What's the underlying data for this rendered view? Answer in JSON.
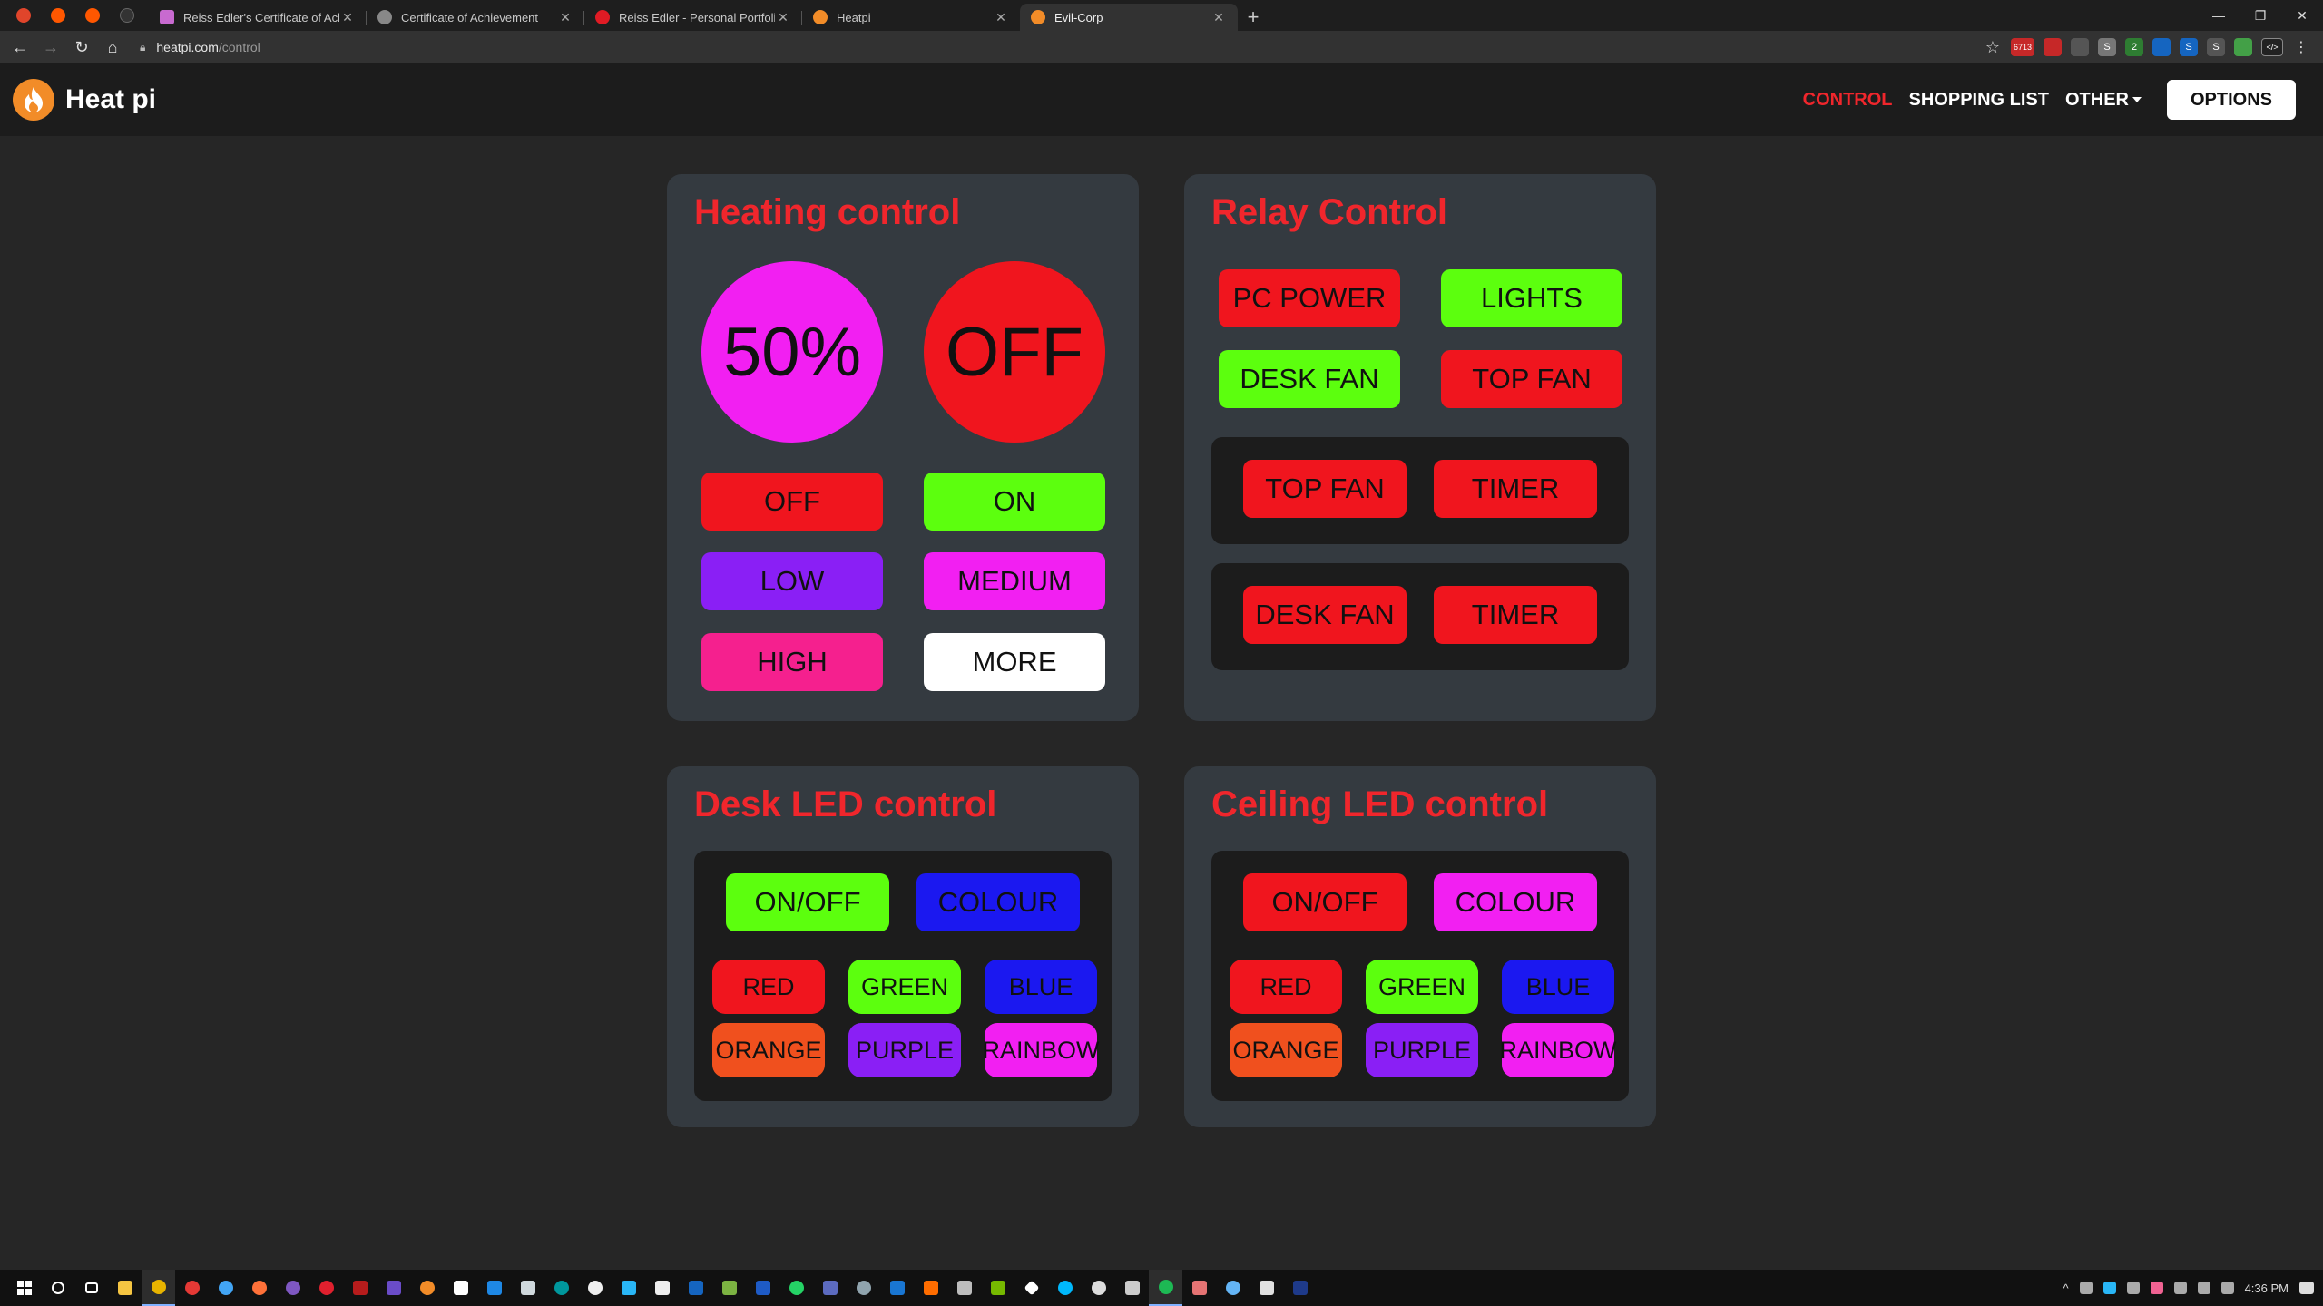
{
  "browser": {
    "pinned_tabs": [
      {
        "icon": "brave-icon",
        "color": "#e0452b"
      },
      {
        "icon": "reddit-icon",
        "color": "#ff5700"
      },
      {
        "icon": "reddit-icon",
        "color": "#ff5700"
      },
      {
        "icon": "github-icon",
        "color": "#333333"
      }
    ],
    "tabs": [
      {
        "title": "Reiss Edler's Certificate of Achievement",
        "favicon_color": "#c86ad0"
      },
      {
        "title": "Certificate of Achievement",
        "favicon_color": "#888888"
      },
      {
        "title": "Reiss Edler - Personal Portfolio",
        "favicon_color": "#e01b24"
      },
      {
        "title": "Heatpi",
        "favicon_color": "#f28c28"
      },
      {
        "title": "Evil-Corp",
        "favicon_color": "#f28c28",
        "active": true
      }
    ],
    "new_tab": "+",
    "url": {
      "host": "heatpi.com",
      "path": "/control"
    },
    "extensions": [
      {
        "label": "6713",
        "color": "#c62828"
      },
      {
        "label": "",
        "color": "#c62828"
      },
      {
        "label": "",
        "color": "#555555"
      },
      {
        "label": "S",
        "color": "#777777"
      },
      {
        "label": "2",
        "color": "#2e7d32"
      },
      {
        "label": "",
        "color": "#1565c0"
      },
      {
        "label": "S",
        "color": "#1565c0"
      },
      {
        "label": "S",
        "color": "#555555"
      },
      {
        "label": "",
        "color": "#43a047"
      },
      {
        "label": "</>",
        "color": "#222222"
      }
    ]
  },
  "app": {
    "brand": "Heat pi",
    "nav": {
      "control": "CONTROL",
      "shopping_list": "SHOPPING LIST",
      "other": "OTHER",
      "options": "OPTIONS"
    },
    "colors": {
      "accent": "#f0262c",
      "card_bg": "#343a40",
      "page_bg": "#262626"
    }
  },
  "heating": {
    "title": "Heating control",
    "level": "50%",
    "state": "OFF",
    "buttons": {
      "off": "OFF",
      "on": "ON",
      "low": "LOW",
      "medium": "MEDIUM",
      "high": "HIGH",
      "more": "MORE"
    }
  },
  "relay": {
    "title": "Relay Control",
    "pc_power": "PC POWER",
    "lights": "LIGHTS",
    "desk_fan": "DESK FAN",
    "top_fan": "TOP FAN",
    "timer_panels": [
      {
        "device": "TOP FAN",
        "timer": "TIMER"
      },
      {
        "device": "DESK FAN",
        "timer": "TIMER"
      }
    ]
  },
  "desk_led": {
    "title": "Desk LED control",
    "on_off": "ON/OFF",
    "colour": "COLOUR",
    "colors": [
      "RED",
      "GREEN",
      "BLUE",
      "ORANGE",
      "PURPLE",
      "RAINBOW"
    ]
  },
  "ceiling_led": {
    "title": "Ceiling LED control",
    "on_off": "ON/OFF",
    "colour": "COLOUR",
    "colors": [
      "RED",
      "GREEN",
      "BLUE",
      "ORANGE",
      "PURPLE",
      "RAINBOW"
    ]
  },
  "taskbar": {
    "clock": "4:36 PM"
  }
}
